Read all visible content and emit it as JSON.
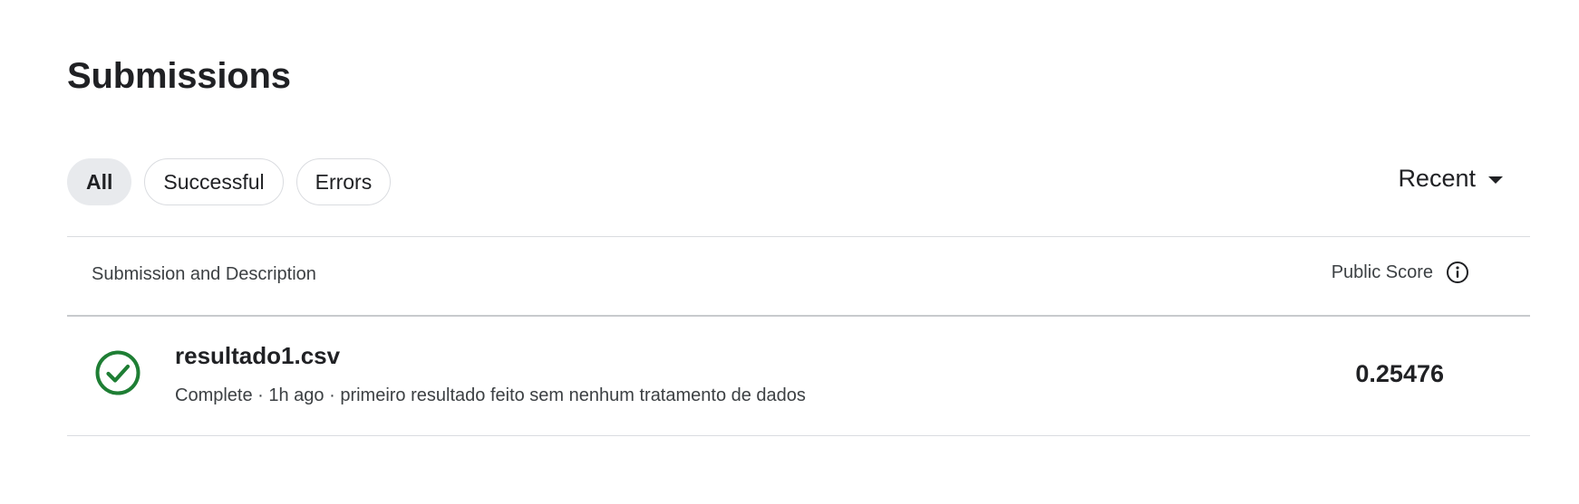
{
  "header": {
    "title": "Submissions"
  },
  "filters": {
    "items": [
      {
        "label": "All",
        "active": true
      },
      {
        "label": "Successful",
        "active": false
      },
      {
        "label": "Errors",
        "active": false
      }
    ]
  },
  "sort": {
    "label": "Recent",
    "icon": "caret-down-icon"
  },
  "table": {
    "columns": {
      "submission": "Submission and Description",
      "score": "Public Score",
      "score_info_icon": "info-icon"
    },
    "rows": [
      {
        "status_icon": "check-circle-icon",
        "status_color": "#1e7e34",
        "file_name": "resultado1.csv",
        "meta": "Complete · 1h ago · primeiro resultado feito sem nenhum tratamento de dados",
        "public_score": "0.25476"
      }
    ]
  },
  "colors": {
    "text": "#202124",
    "muted": "#3c4043",
    "chip_active_bg": "#e8eaed",
    "border": "#dadce0",
    "success": "#1e7e34"
  }
}
